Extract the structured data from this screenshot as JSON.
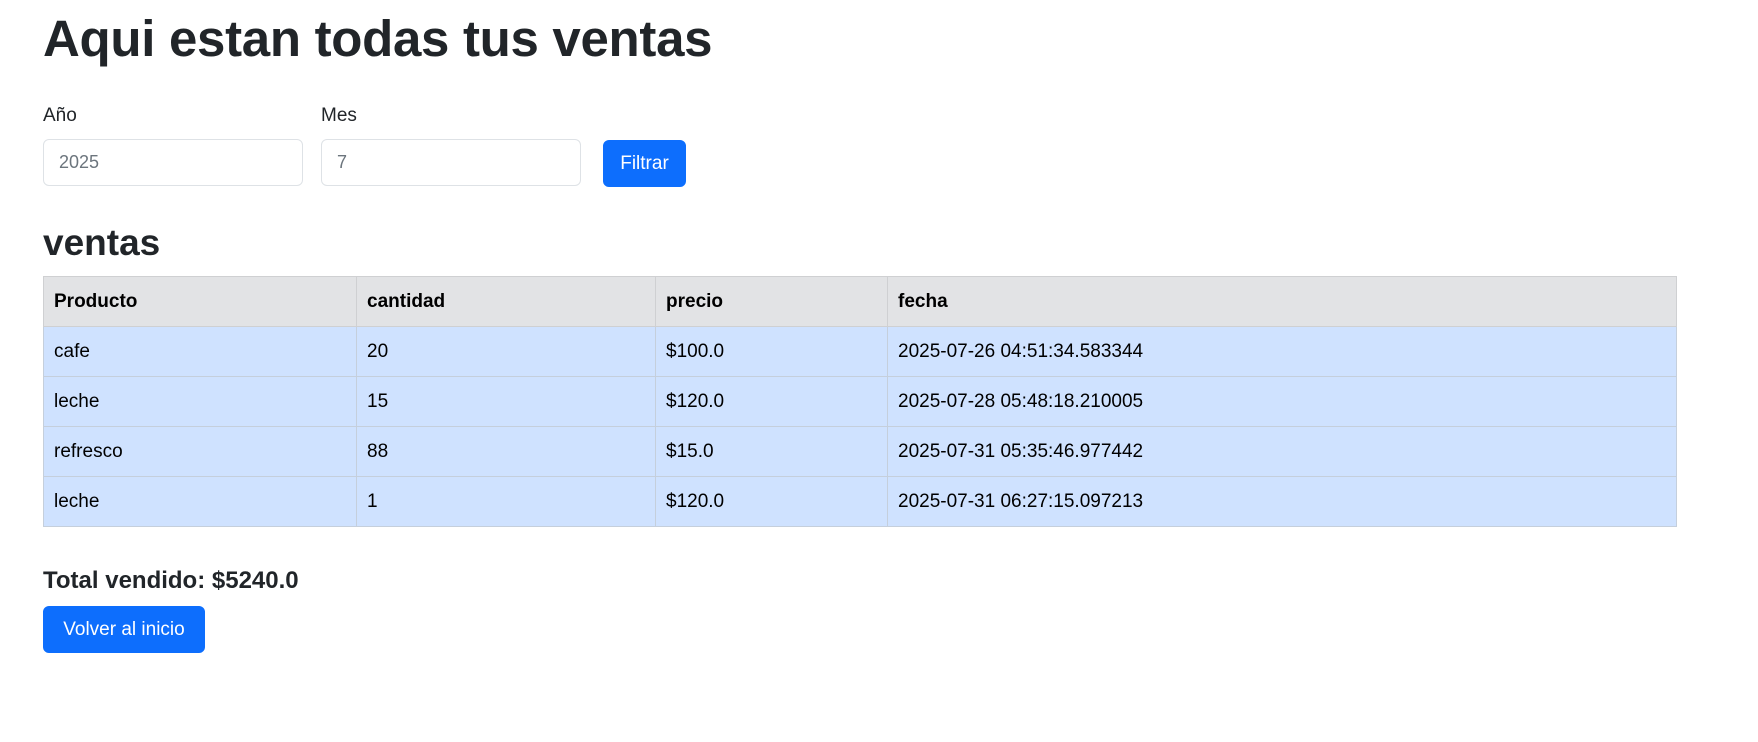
{
  "page": {
    "title": "Aqui estan todas tus ventas"
  },
  "filters": {
    "year_label": "Año",
    "year_value": "2025",
    "month_label": "Mes",
    "month_value": "7",
    "filter_button": "Filtrar"
  },
  "sales": {
    "section_title": "ventas",
    "columns": [
      "Producto",
      "cantidad",
      "precio",
      "fecha"
    ],
    "rows": [
      {
        "producto": "cafe",
        "cantidad": "20",
        "precio": "$100.0",
        "fecha": "2025-07-26 04:51:34.583344"
      },
      {
        "producto": "leche",
        "cantidad": "15",
        "precio": "$120.0",
        "fecha": "2025-07-28 05:48:18.210005"
      },
      {
        "producto": "refresco",
        "cantidad": "88",
        "precio": "$15.0",
        "fecha": "2025-07-31 05:35:46.977442"
      },
      {
        "producto": "leche",
        "cantidad": "1",
        "precio": "$120.0",
        "fecha": "2025-07-31 06:27:15.097213"
      }
    ]
  },
  "summary": {
    "total_text": "Total vendido: $5240.0",
    "home_button": "Volver al inicio"
  },
  "colors": {
    "primary": "#0d6efd",
    "table_header_bg": "#e2e3e5",
    "table_row_bg": "#cfe2ff"
  }
}
